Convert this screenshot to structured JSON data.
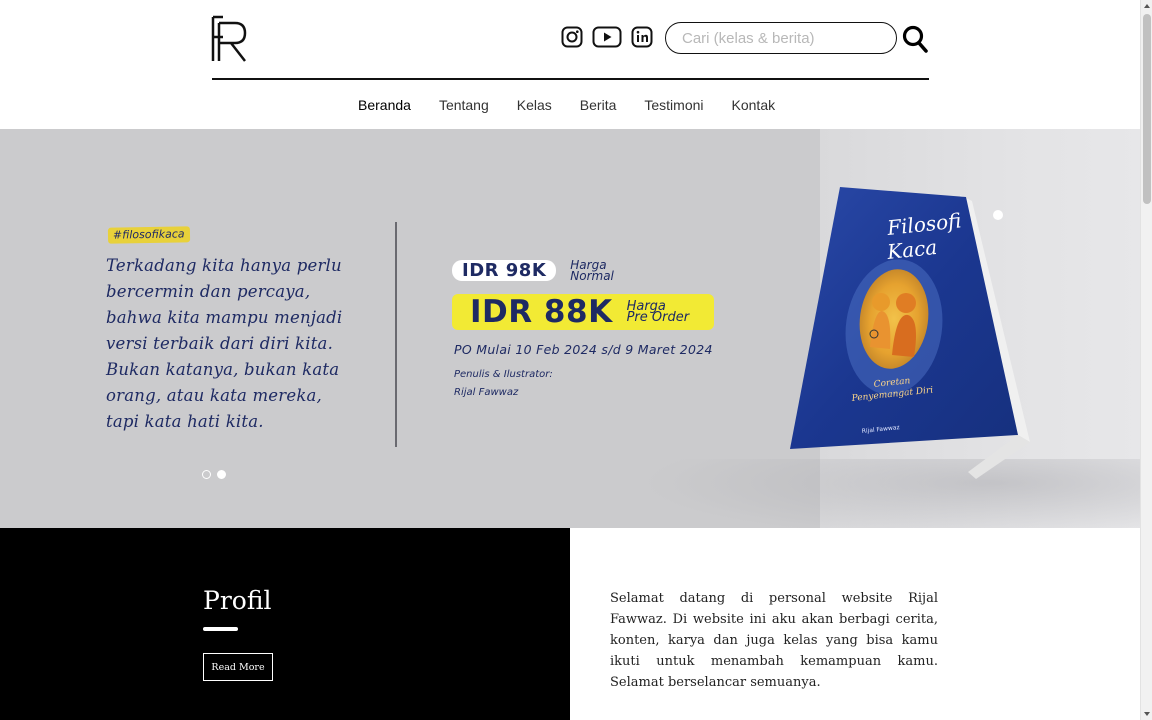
{
  "header": {
    "logo_text": "RF",
    "search": {
      "placeholder": "Cari (kelas & berita)",
      "value": ""
    },
    "socials": [
      {
        "name": "instagram"
      },
      {
        "name": "youtube"
      },
      {
        "name": "linkedin"
      }
    ]
  },
  "nav": {
    "items": [
      {
        "label": "Beranda",
        "active": true
      },
      {
        "label": "Tentang"
      },
      {
        "label": "Kelas"
      },
      {
        "label": "Berita"
      },
      {
        "label": "Testimoni"
      },
      {
        "label": "Kontak"
      }
    ]
  },
  "hero": {
    "tag": "#filosofikaca",
    "quote_lines": [
      "Terkadang kita hanya perlu",
      "bercermin dan percaya,",
      "bahwa kita mampu menjadi",
      "versi terbaik dari diri kita.",
      "Bukan katanya, bukan kata",
      "orang, atau kata mereka,",
      "tapi kata hati kita."
    ],
    "price_normal": "IDR 98K",
    "price_normal_label_1": "Harga",
    "price_normal_label_2": "Normal",
    "price_po": "IDR 88K",
    "price_po_label_1": "Harga",
    "price_po_label_2": "Pre Order",
    "po_date": "PO Mulai 10 Feb 2024 s/d 9 Maret 2024",
    "author_label": "Penulis & Ilustrator:",
    "author": "Rijal Fawwaz",
    "book": {
      "title_1": "Filosofi",
      "title_2": "Kaca",
      "subtitle_1": "Coretan",
      "subtitle_2": "Penyemangat Diri",
      "author": "Rijal Fawwaz"
    },
    "slides": 2,
    "active_slide": 2
  },
  "profil": {
    "title": "Profil",
    "read_more": "Read More",
    "intro": "Selamat datang di personal website Rijal Fawwaz. Di website ini aku akan berbagi cerita, konten, karya dan juga kelas yang bisa kamu ikuti untuk menambah kemampuan kamu. Selamat berselancar semuanya."
  },
  "colors": {
    "navy": "#1e2a63",
    "yellow": "#f2ea34",
    "hero_bg": "#cbcbcd"
  }
}
